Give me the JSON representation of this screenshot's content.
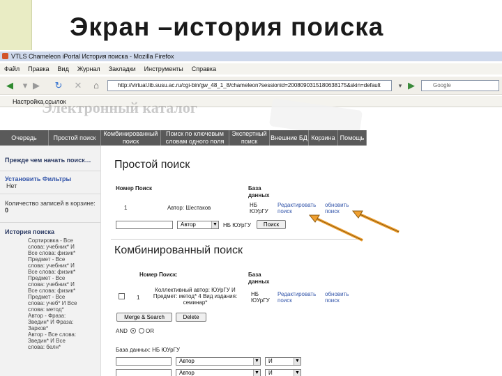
{
  "slide_title": "Экран –история поиска",
  "browser": {
    "window_title": "VTLS Chameleon iPortal История поиска - Mozilla Firefox",
    "menu": [
      "Файл",
      "Правка",
      "Вид",
      "Журнал",
      "Закладки",
      "Инструменты",
      "Справка"
    ],
    "url": "http://virtual.lib.susu.ac.ru/cgi-bin/gw_48_1_8/chameleon?sessionid=2008090315180638175&skin=default",
    "search_placeholder": "Google",
    "bookmark": "Настройка ссылок"
  },
  "catalog_ghost": "Электронный каталог",
  "tabs": [
    {
      "label": "Очередь"
    },
    {
      "label": "Простой поиск"
    },
    {
      "label": "Комбинированный поиск"
    },
    {
      "label": "Поиск по ключевым словам одного поля"
    },
    {
      "label": "Экспертный поиск"
    },
    {
      "label": "Внешние БД"
    },
    {
      "label": "Корзина"
    },
    {
      "label": "Помощь"
    }
  ],
  "sidebar": {
    "prompt": "Прежде чем начать поиск…",
    "filters_link": "Установить Фильтры",
    "filters_sub": "Нет",
    "records_text": "Количество записей в корзине:",
    "records_count": "0",
    "history_title": "История поиска",
    "history_lines": [
      "Сортировка - Все",
      "слова: учебник* И",
      "Все слова: физик*",
      "Предмет - Все",
      "слова: учебник* И",
      "Все слова: физик*",
      "Предмет - Все",
      "слова: учебник* И",
      "Все слова: физик*",
      "Предмет - Все",
      "слова: учеб* И Все",
      "слова: метод*",
      "Автор - Фраза:",
      "Зведин* И Фраза:",
      "Зарков*",
      "Автор - Все слова:",
      "Зведин* И Все",
      "слова: белн*"
    ]
  },
  "simple": {
    "heading": "Простой поиск",
    "col_num": "Номер Поиск",
    "col_db": "База данных",
    "row_num": "1",
    "row_query": "Автор: Шестаков",
    "row_db": "НБ ЮУрГУ",
    "row_edit": "Редактировать поиск",
    "row_refresh": "обновить поиск",
    "field_select": "Автор",
    "in_text": "НБ ЮУрГУ",
    "search_button": "Поиск"
  },
  "combined": {
    "heading": "Комбинированный поиск",
    "col_num": "Номер Поиск:",
    "col_db": "База данных",
    "row_num": "1",
    "row_query": "Коллективный автор: ЮУрГУ И Предмет: метод* 4 Вид издания: семинар*",
    "row_db": "НБ ЮУрГУ",
    "row_edit": "Редактировать поиск",
    "row_refresh": "обновить поиск",
    "merge_button": "Merge & Search",
    "delete_button": "Delete",
    "and_label": "AND",
    "or_label": "OR",
    "db_label": "База данных: НБ ЮУрГУ",
    "select1": "Автор",
    "op1": "И",
    "select2": "Автор",
    "op2": "И"
  },
  "colors": {
    "tab_bar": "#5a5a5a",
    "arrow": "#f0a030",
    "link": "#3355aa"
  }
}
